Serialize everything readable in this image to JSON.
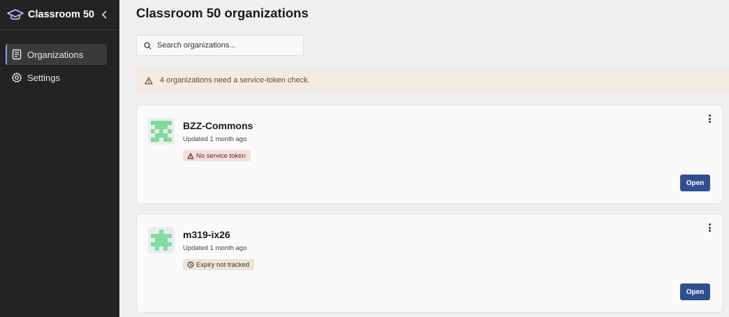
{
  "sidebar": {
    "brand": {
      "title": "Classroom 50",
      "icon": "graduation-cap-icon",
      "collapse_icon": "chevron-left-icon"
    },
    "items": [
      {
        "label": "Organizations",
        "icon": "book-icon",
        "active": true
      },
      {
        "label": "Settings",
        "icon": "gear-icon",
        "active": false
      }
    ]
  },
  "main": {
    "title": "Classroom 50 organizations",
    "search": {
      "placeholder": "Search organizations...",
      "value": ""
    },
    "banner": {
      "text": "4 organizations need a service-token check.",
      "icon": "warning-icon"
    },
    "organizations": [
      {
        "name": "BZZ-Commons",
        "updated": "Updated 1 month ago",
        "badge": "No service token",
        "badge_icon": "warning-icon",
        "badge_color": "#f3e0dd",
        "open_label": "Open"
      },
      {
        "name": "m319-ix26",
        "updated": "Updated 1 month ago",
        "badge": "Expiry not tracked",
        "badge_icon": "clock-icon",
        "badge_color": "#ece4d8",
        "open_label": "Open"
      }
    ]
  },
  "colors": {
    "accent": "#2f4f91",
    "sidebar_bg": "#232323",
    "avatar_green": "#7ddc9b"
  }
}
